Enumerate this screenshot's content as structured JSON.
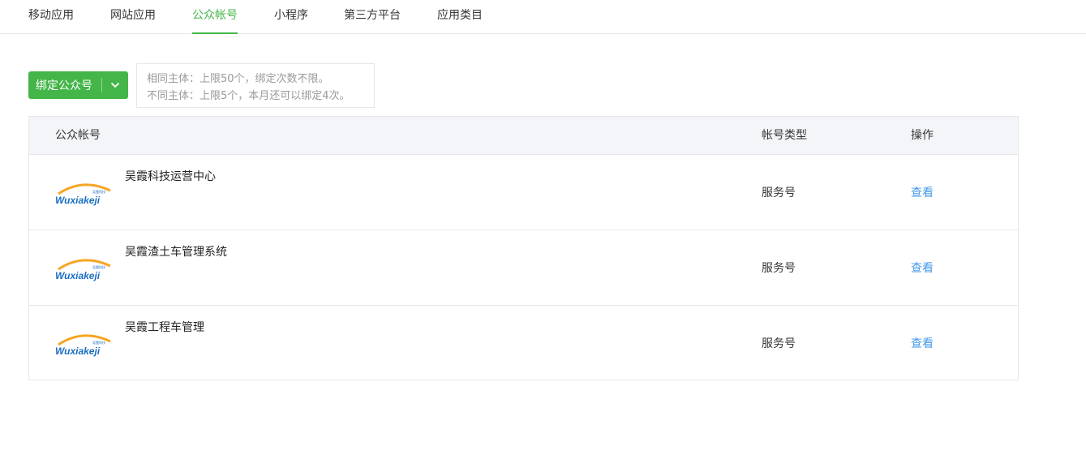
{
  "tabs": [
    {
      "label": "移动应用",
      "active": false
    },
    {
      "label": "网站应用",
      "active": false
    },
    {
      "label": "公众帐号",
      "active": true
    },
    {
      "label": "小程序",
      "active": false
    },
    {
      "label": "第三方平台",
      "active": false
    },
    {
      "label": "应用类目",
      "active": false
    }
  ],
  "bind_button": {
    "label": "绑定公众号",
    "icon": "chevron-down-icon"
  },
  "tip": {
    "line1": "相同主体：上限50个，绑定次数不限。",
    "line2": "不同主体：上限5个，本月还可以绑定4次。"
  },
  "table": {
    "headers": {
      "account": "公众帐号",
      "type": "帐号类型",
      "action": "操作"
    },
    "rows": [
      {
        "name": "吴霞科技运营中心",
        "type": "服务号",
        "action": "查看",
        "logo_text": "Wuxiakeji",
        "logo_sub": "吴霞科技"
      },
      {
        "name": "吴霞渣土车管理系统",
        "type": "服务号",
        "action": "查看",
        "logo_text": "Wuxiakeji",
        "logo_sub": "吴霞科技"
      },
      {
        "name": "吴霞工程车管理",
        "type": "服务号",
        "action": "查看",
        "logo_text": "Wuxiakeji",
        "logo_sub": "吴霞科技"
      }
    ]
  },
  "colors": {
    "accent": "#44b549",
    "link": "#459ae9",
    "header_bg": "#f4f5f9",
    "logo_orange": "#f5a623",
    "logo_blue": "#1b6fc1"
  }
}
